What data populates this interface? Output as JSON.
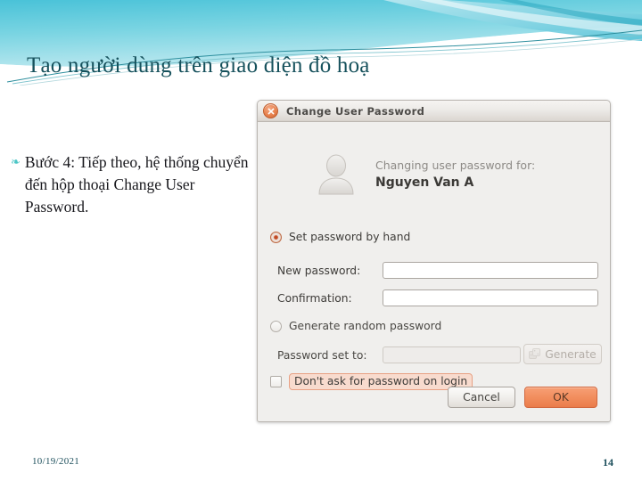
{
  "slide": {
    "title": "Tạo người dùng trên giao diện đồ hoạ",
    "bullet_glyph": "❧",
    "bullet_text": "Bước 4: Tiếp theo, hệ thống chuyển đến hộp thoại Change User Password.",
    "footer_date": "10/19/2021",
    "page_number": "14",
    "title_color": "#16515c",
    "bullet_glyph_color": "#4cc6c6",
    "header_wave_colors": [
      "#5bc9dd",
      "#9fe0ea",
      "#2fa8bd",
      "#1a7f92",
      "#ffffff"
    ]
  },
  "dialog": {
    "titlebar": {
      "title": "Change User Password",
      "close_icon": "close-icon"
    },
    "header": {
      "avatar_icon": "user-avatar-icon",
      "changing_for_label": "Changing user password for:",
      "user_name": "Nguyen Van A"
    },
    "options": {
      "set_by_hand": {
        "label": "Set password by hand",
        "selected": true
      },
      "generate_random": {
        "label": "Generate random password",
        "selected": false
      }
    },
    "fields": {
      "new_password": {
        "label": "New password:",
        "value": "",
        "placeholder": "",
        "disabled": false
      },
      "confirmation": {
        "label": "Confirmation:",
        "value": "",
        "placeholder": "",
        "disabled": false
      },
      "password_set_to": {
        "label": "Password set to:",
        "value": "",
        "placeholder": "",
        "disabled": true
      }
    },
    "generate_button": {
      "label": "Generate",
      "icon": "dice-icon",
      "disabled": true
    },
    "dont_ask": {
      "label": "Don't ask for password on login",
      "checked": false,
      "highlight_bg": "#f8dbce",
      "highlight_border": "#e8a184"
    },
    "actions": {
      "cancel_label": "Cancel",
      "ok_label": "OK",
      "ok_color": "#ef8a58"
    },
    "accent_color": "#e8824e"
  }
}
